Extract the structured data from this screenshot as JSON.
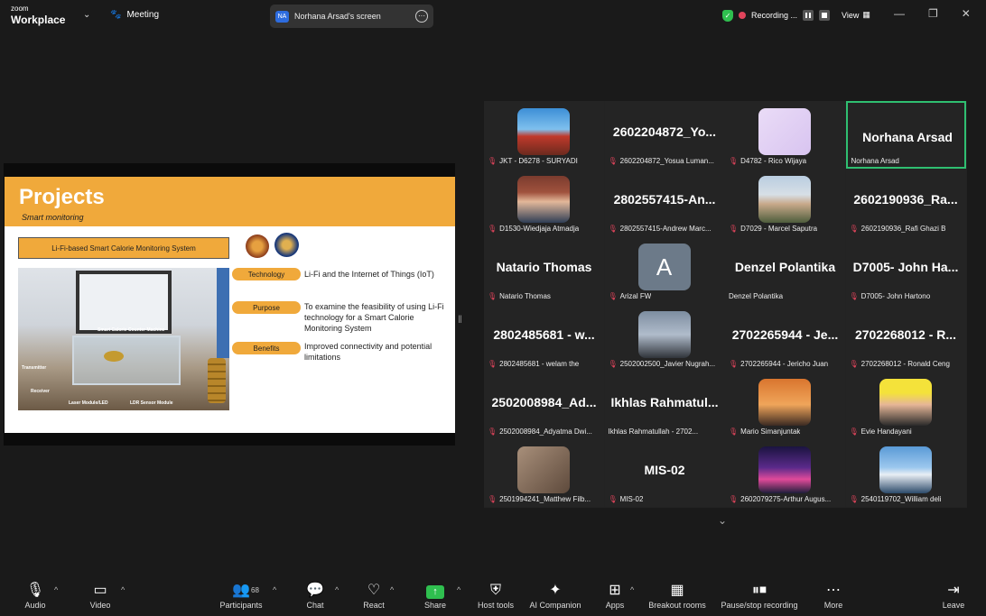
{
  "app": {
    "brand_top": "zoom",
    "brand_main": "Workplace"
  },
  "topbar": {
    "meeting_label": "Meeting",
    "screen_badge": "NA",
    "screen_title": "Norhana Arsad's screen",
    "recording_label": "Recording ...",
    "view_label": "View"
  },
  "slide": {
    "title": "Projects",
    "subtitle": "Smart monitoring",
    "system_title": "Li-Fi-based Smart Calorie Monitoring System",
    "photo_labels": {
      "machine": "Smart Calorie Counter Machine",
      "transmitter": "Transmitter",
      "receiver": "Receiver",
      "laser": "Laser Module/LED",
      "ldr": "LDR Sensor Module"
    },
    "rows": [
      {
        "label": "Technology",
        "text": "Li-Fi and the Internet of Things (IoT)"
      },
      {
        "label": "Purpose",
        "text": "To examine the feasibility of using Li-Fi technology for a Smart Calorie Monitoring System"
      },
      {
        "label": "Benefits",
        "text": "Improved connectivity and potential limitations"
      }
    ]
  },
  "gallery": {
    "tiles": [
      {
        "big": "",
        "name": "JKT - D6278 - SURYADI",
        "avatar": "photo-temple"
      },
      {
        "big": "2602204872_Yo...",
        "name": "2602204872_Yosua Luman...",
        "avatar": ""
      },
      {
        "big": "",
        "name": "D4782 - Rico Wijaya",
        "avatar": "photo-lavender"
      },
      {
        "big": "Norhana Arsad",
        "name": "Norhana Arsad",
        "avatar": "",
        "active": true
      },
      {
        "big": "",
        "name": "D1530-Wiedjaja Atmadja",
        "avatar": "photo-man-glasses"
      },
      {
        "big": "2802557415-An...",
        "name": "2802557415-Andrew Marc...",
        "avatar": ""
      },
      {
        "big": "",
        "name": "D7029 - Marcel Saputra",
        "avatar": "photo-man-outdoor"
      },
      {
        "big": "2602190936_Ra...",
        "name": "2602190936_Rafi Ghazi B",
        "avatar": ""
      },
      {
        "big": "Natario Thomas",
        "name": "Natario Thomas",
        "avatar": ""
      },
      {
        "big": "",
        "name": "Arizal FW",
        "avatar": "letter",
        "letter": "A"
      },
      {
        "big": "Denzel Polantika",
        "name": "Denzel Polantika",
        "avatar": "",
        "unmuted": true
      },
      {
        "big": "D7005- John Ha...",
        "name": "D7005- John Hartono",
        "avatar": ""
      },
      {
        "big": "2802485681 - w...",
        "name": "2802485681 - welam the",
        "avatar": ""
      },
      {
        "big": "",
        "name": "2502002500_Javier Nugrah...",
        "avatar": "photo-sky"
      },
      {
        "big": "2702265944 - Je...",
        "name": "2702265944 - Jericho Juan",
        "avatar": ""
      },
      {
        "big": "2702268012 - R...",
        "name": "2702268012 - Ronald Ceng",
        "avatar": ""
      },
      {
        "big": "2502008984_Ad...",
        "name": "2502008984_Adyatma Dwi...",
        "avatar": ""
      },
      {
        "big": "Ikhlas Rahmatul...",
        "name": "Ikhlas Rahmatullah - 2702...",
        "avatar": "",
        "unmuted": true
      },
      {
        "big": "",
        "name": "Mario Simanjuntak",
        "avatar": "photo-sunset"
      },
      {
        "big": "",
        "name": "Evie Handayani",
        "avatar": "photo-woman"
      },
      {
        "big": "",
        "name": "2501994241_Matthew Filb...",
        "avatar": "photo-blur"
      },
      {
        "big": "MIS-02",
        "name": "MIS-02",
        "avatar": ""
      },
      {
        "big": "",
        "name": "2602079275-Arthur Augus...",
        "avatar": "photo-galaxy"
      },
      {
        "big": "",
        "name": "2540119702_William deli",
        "avatar": "photo-mountain"
      }
    ]
  },
  "toolbar": {
    "audio": "Audio",
    "video": "Video",
    "participants": "Participants",
    "participants_count": "68",
    "chat": "Chat",
    "react": "React",
    "share": "Share",
    "host_tools": "Host tools",
    "ai_companion": "AI Companion",
    "apps": "Apps",
    "breakout": "Breakout rooms",
    "pause_recording": "Pause/stop recording",
    "more": "More",
    "leave": "Leave"
  },
  "colors": {
    "accent_green": "#2fbf71",
    "slide_orange": "#f0a93b",
    "mic_red": "#e0445b",
    "share_green": "#2fbf4f"
  }
}
